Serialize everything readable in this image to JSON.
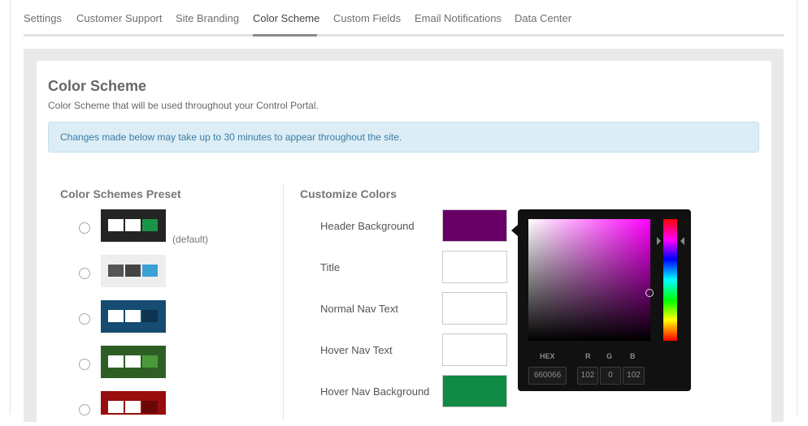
{
  "tabs": [
    {
      "label": "Settings",
      "active": false
    },
    {
      "label": "Customer Support",
      "active": false
    },
    {
      "label": "Site Branding",
      "active": false
    },
    {
      "label": "Color Scheme",
      "active": true
    },
    {
      "label": "Custom Fields",
      "active": false
    },
    {
      "label": "Email Notifications",
      "active": false
    },
    {
      "label": "Data Center",
      "active": false
    }
  ],
  "page": {
    "title": "Color Scheme",
    "subtitle": "Color Scheme that will be used throughout your Control Portal.",
    "alert": "Changes made below may take up to 30 minutes to appear throughout the site."
  },
  "presets": {
    "heading": "Color Schemes Preset",
    "default_label": "(default)",
    "items": [
      {
        "bg": "#242424",
        "colors": [
          "#ffffff",
          "#ffffff",
          "#1a9446"
        ]
      },
      {
        "bg": "#eeeeee",
        "colors": [
          "#555555",
          "#444444",
          "#3aa0d6"
        ]
      },
      {
        "bg": "#164b72",
        "colors": [
          "#ffffff",
          "#ffffff",
          "#0e3350"
        ]
      },
      {
        "bg": "#2f5e25",
        "colors": [
          "#ffffff",
          "#ffffff",
          "#4a9a3a"
        ]
      },
      {
        "bg": "#980d0d",
        "colors": [
          "#ffffff",
          "#ffffff",
          "#6a0707"
        ]
      }
    ]
  },
  "customize": {
    "heading": "Customize Colors",
    "fields": [
      {
        "label": "Header Background",
        "color": "#660066"
      },
      {
        "label": "Title",
        "color": "#ffffff"
      },
      {
        "label": "Normal Nav Text",
        "color": "#ffffff"
      },
      {
        "label": "Hover Nav Text",
        "color": "#ffffff"
      },
      {
        "label": "Hover Nav Background",
        "color": "#108a45"
      }
    ]
  },
  "picker": {
    "hex_label": "HEX",
    "r_label": "R",
    "g_label": "G",
    "b_label": "B",
    "hex": "660066",
    "r": "102",
    "g": "0",
    "b": "102"
  }
}
